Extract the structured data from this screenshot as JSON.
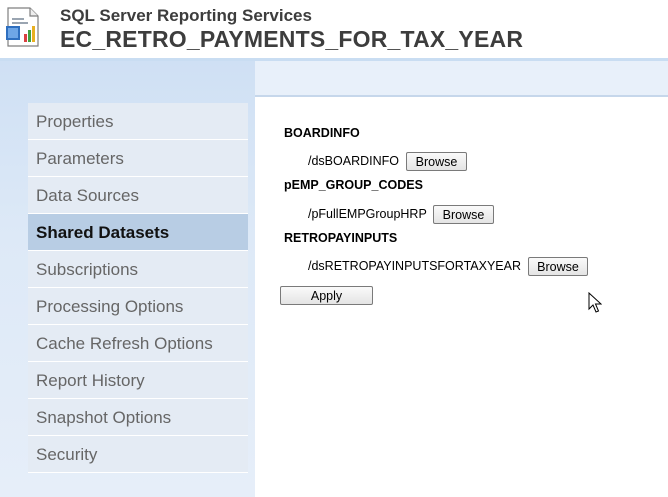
{
  "header": {
    "app_title": "SQL Server Reporting Services",
    "report_title": "EC_RETRO_PAYMENTS_FOR_TAX_YEAR"
  },
  "sidebar": {
    "items": [
      {
        "label": "Properties",
        "active": false
      },
      {
        "label": "Parameters",
        "active": false
      },
      {
        "label": "Data Sources",
        "active": false
      },
      {
        "label": "Shared Datasets",
        "active": true
      },
      {
        "label": "Subscriptions",
        "active": false
      },
      {
        "label": "Processing Options",
        "active": false
      },
      {
        "label": "Cache Refresh Options",
        "active": false
      },
      {
        "label": "Report History",
        "active": false
      },
      {
        "label": "Snapshot Options",
        "active": false
      },
      {
        "label": "Security",
        "active": false
      }
    ]
  },
  "datasets": [
    {
      "name": "BOARDINFO",
      "path": "/dsBOARDINFO",
      "button": "Browse"
    },
    {
      "name": "pEMP_GROUP_CODES",
      "path": "/pFullEMPGroupHRP",
      "button": "Browse"
    },
    {
      "name": "RETROPAYINPUTS",
      "path": "/dsRETROPAYINPUTSFORTAXYEAR",
      "button": "Browse"
    }
  ],
  "apply_label": "Apply",
  "colors": {
    "sidebar_active": "#b8cde4",
    "sidebar_item": "#e4ebf4",
    "title_text": "#3d3d3d"
  }
}
